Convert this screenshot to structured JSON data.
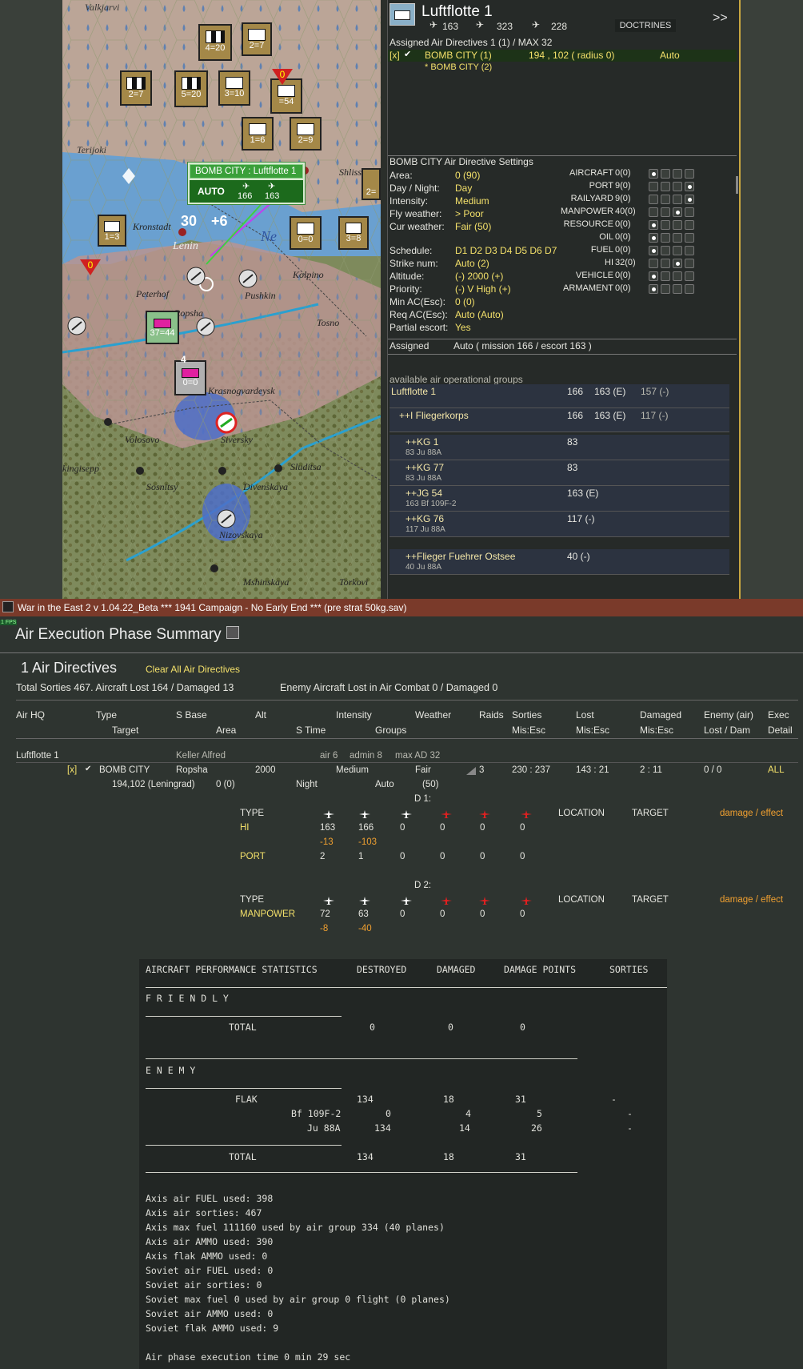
{
  "map": {
    "places": [
      "Valkjarvi",
      "Terijoki",
      "Kronstadt",
      "Peterhof",
      "Ropsha",
      "Pushkin",
      "Kolpino",
      "Tosno",
      "Krasnogvardeysk",
      "Volosovo",
      "Siversky",
      "Sluditsa",
      "Sosnitsy",
      "Divenskaya",
      "Nizovskaya",
      "Mshinskaya",
      "Torkovi",
      "Shlisselburg",
      "Ne",
      "Lenin",
      "kingisepp"
    ],
    "units": [
      {
        "label": "4=20"
      },
      {
        "label": "2=7"
      },
      {
        "label": "2=7"
      },
      {
        "label": "5=20"
      },
      {
        "label": "3=10"
      },
      {
        "label": "=54"
      },
      {
        "label": "1=6"
      },
      {
        "label": "2=9"
      },
      {
        "label": "1=3"
      },
      {
        "label": "0=0"
      },
      {
        "label": "3=8"
      },
      {
        "label": "37=44"
      },
      {
        "label": "0=0"
      },
      {
        "label": "2="
      },
      {
        "label": "0"
      },
      {
        "label": "0"
      },
      {
        "label": "4"
      }
    ],
    "tooltip": {
      "title": "BOMB CITY : Luftflotte 1",
      "mode": "AUTO",
      "bombers": "166",
      "fighters": "163"
    },
    "overlay": {
      "left": "30",
      "right": "+6"
    }
  },
  "hq": {
    "name": "Luftflotte 1",
    "fighters": "163",
    "bombers": "323",
    "recon": "228",
    "doctrines": "DOCTRINES",
    "next": ">>"
  },
  "assigned": {
    "header": "Assigned Air Directives 1 (1) / MAX 32",
    "row": {
      "flag": "[x]",
      "name": "BOMB CITY (1)",
      "coords": "194 , 102 ( radius 0)",
      "mode": "Auto"
    },
    "sub": "* BOMB CITY (2)"
  },
  "settings": {
    "header": "BOMB CITY Air Directive Settings",
    "fields": [
      {
        "label": "Area:",
        "value": "0 (90)"
      },
      {
        "label": "Day / Night:",
        "value": "Day"
      },
      {
        "label": "Intensity:",
        "value": "Medium"
      },
      {
        "label": "Fly weather:",
        "value": "> Poor"
      },
      {
        "label": "Cur weather:",
        "value": "Fair (50)"
      },
      {
        "label": "Schedule:",
        "value": "D1 D2 D3 D4 D5 D6 D7"
      },
      {
        "label": "Strike num:",
        "value": "Auto (2)"
      },
      {
        "label": "Altitude:",
        "value": "(-) 2000 (+)"
      },
      {
        "label": "Priority:",
        "value": "(-) V High (+)"
      },
      {
        "label": "Min AC(Esc):",
        "value": "0 (0)"
      },
      {
        "label": "Req AC(Esc):",
        "value": "Auto (Auto)"
      },
      {
        "label": "Partial escort:",
        "value": "Yes"
      }
    ],
    "targets": [
      {
        "label": "AIRCRAFT",
        "count": "0(0)",
        "sel": 0
      },
      {
        "label": "PORT",
        "count": "9(0)",
        "sel": 3
      },
      {
        "label": "RAILYARD",
        "count": "9(0)",
        "sel": 3
      },
      {
        "label": "MANPOWER",
        "count": "40(0)",
        "sel": 2
      },
      {
        "label": "RESOURCE",
        "count": "0(0)",
        "sel": 0
      },
      {
        "label": "OIL",
        "count": "0(0)",
        "sel": 0
      },
      {
        "label": "FUEL",
        "count": "0(0)",
        "sel": 0
      },
      {
        "label": "HI",
        "count": "32(0)",
        "sel": 2
      },
      {
        "label": "VEHICLE",
        "count": "0(0)",
        "sel": 0
      },
      {
        "label": "ARMAMENT",
        "count": "0(0)",
        "sel": 0
      }
    ],
    "assigned_label": "Assigned",
    "assigned_value": "Auto  ( mission 166 / escort 163 )"
  },
  "groups": {
    "header": "available air operational groups",
    "items": [
      {
        "name": "Luftflotte 1",
        "sub": "",
        "a": "166",
        "b": "163 (E)",
        "c": "157 (-)"
      },
      {
        "name": "++I Fliegerkorps",
        "sub": "",
        "a": "166",
        "b": "163 (E)",
        "c": "117 (-)"
      },
      {
        "name": "++KG 1",
        "sub": "83 Ju 88A",
        "a": "83",
        "b": "",
        "c": ""
      },
      {
        "name": "++KG 77",
        "sub": "83 Ju 88A",
        "a": "83",
        "b": "",
        "c": ""
      },
      {
        "name": "++JG 54",
        "sub": "163 Bf 109F-2",
        "a": "163 (E)",
        "b": "",
        "c": ""
      },
      {
        "name": "++KG 76",
        "sub": "117 Ju 88A",
        "a": "117 (-)",
        "b": "",
        "c": ""
      },
      {
        "name": "++Flieger Fuehrer Ostsee",
        "sub": "40 Ju 88A",
        "a": "40 (-)",
        "b": "",
        "c": ""
      }
    ]
  },
  "window": {
    "title": "War in the East 2  v 1.04.22_Beta    ***  1941 Campaign - No Early End  ***   (pre strat 50kg.sav)",
    "fps": "1 FPS"
  },
  "summary": {
    "title": "Air Execution Phase Summary",
    "directives": "1 Air Directives",
    "clear": "Clear All Air Directives",
    "totals": "Total Sorties 467. Aircraft Lost 164 / Damaged 13",
    "enemy": "Enemy Aircraft Lost in Air Combat 0 / Damaged 0",
    "headers1": [
      "Air HQ",
      "Type",
      "S Base",
      "Alt",
      "Intensity",
      "Weather",
      "Raids",
      "Sorties",
      "Lost",
      "Damaged",
      "Enemy (air)",
      "Exec"
    ],
    "headers2": [
      "Target",
      "Area",
      "S Time",
      "Groups",
      "Mis:Esc",
      "Mis:Esc",
      "Mis:Esc",
      "Lost / Dam",
      "Detail"
    ],
    "hq_row": {
      "name": "Luftflotte 1",
      "commander": "Keller Alfred",
      "air": "air 6",
      "admin": "admin 8",
      "maxad": "max AD 32"
    },
    "dir_row": {
      "flag": "[x]",
      "type": "BOMB CITY",
      "base": "Ropsha",
      "alt": "2000",
      "intensity": "Medium",
      "weather": "Fair",
      "raids": "3",
      "sorties": "230 : 237",
      "lost": "143 : 21",
      "damaged": "2 : 11",
      "enemy": "0 / 0",
      "exec": "ALL"
    },
    "dir_row2": {
      "target": "194,102 (Leningrad)",
      "area": "0 (0)",
      "stime": "Night",
      "groups": "Auto",
      "wval": "(50)"
    },
    "d1": {
      "label": "D 1:",
      "type": "TYPE",
      "location": "LOCATION",
      "target": "TARGET",
      "effect": "damage / effect",
      "rows": [
        {
          "name": "HI",
          "vals": [
            "163",
            "166",
            "0",
            "0",
            "0",
            "0"
          ],
          "loss": [
            "-13",
            "-103"
          ]
        },
        {
          "name": "PORT",
          "vals": [
            "2",
            "1",
            "0",
            "0",
            "0",
            "0"
          ],
          "loss": []
        }
      ]
    },
    "d2": {
      "label": "D 2:",
      "type": "TYPE",
      "location": "LOCATION",
      "target": "TARGET",
      "effect": "damage / effect",
      "rows": [
        {
          "name": "MANPOWER",
          "vals": [
            "72",
            "63",
            "0",
            "0",
            "0",
            "0"
          ],
          "loss": [
            "-8",
            "-40"
          ]
        }
      ]
    }
  },
  "stats": {
    "header": [
      "AIRCRAFT PERFORMANCE STATISTICS",
      "DESTROYED",
      "DAMAGED",
      "DAMAGE POINTS",
      "SORTIES"
    ],
    "friendly": "F R I E N D L Y",
    "friendly_total": {
      "label": "TOTAL",
      "destroyed": "0",
      "damaged": "0",
      "points": "0"
    },
    "enemy": "E N E M Y",
    "flak": {
      "label": "FLAK",
      "destroyed": "134",
      "damaged": "18",
      "points": "31",
      "sorties": "-"
    },
    "rows": [
      {
        "label": "Bf 109F-2",
        "destroyed": "0",
        "damaged": "4",
        "points": "5",
        "sorties": "-"
      },
      {
        "label": "Ju 88A",
        "destroyed": "134",
        "damaged": "14",
        "points": "26",
        "sorties": "-"
      }
    ],
    "enemy_total": {
      "label": "TOTAL",
      "destroyed": "134",
      "damaged": "18",
      "points": "31"
    },
    "log": [
      "Axis air FUEL used: 398",
      "Axis air sorties: 467",
      "Axis max fuel 111160 used by air group 334 (40 planes)",
      "Axis air AMMO used: 390",
      "Axis flak AMMO used: 0",
      "Soviet air FUEL used: 0",
      "Soviet air sorties: 0",
      "Soviet max fuel 0 used by air group 0 flight (0 planes)",
      "Soviet air AMMO used: 0",
      "Soviet flak AMMO used: 9"
    ],
    "exec_time": "Air phase execution time 0 min 29 sec"
  }
}
